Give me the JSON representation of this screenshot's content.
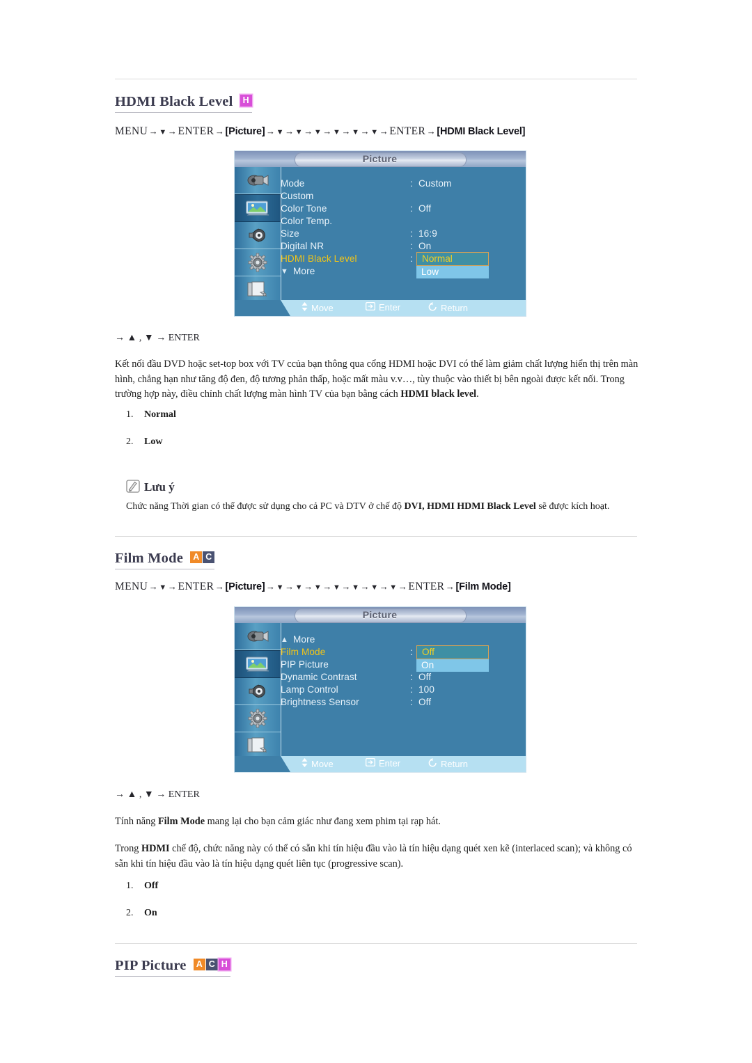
{
  "page": {
    "sections": [
      {
        "id": "hdmi-black-level",
        "heading": "HDMI Black Level",
        "badges": [
          "H"
        ],
        "breadcrumb": {
          "start": "MENU",
          "enter": "ENTER",
          "tag1": "[Picture]",
          "down_count_1": 1,
          "down_count_2": 6,
          "tag2": "[HDMI Black Level]"
        },
        "keyline": "→ ▲ , ▼ → ENTER",
        "paragraph_html": "Kết nối đầu DVD hoặc set-top box với TV ccủa bạn thông qua cổng HDMI hoặc DVI có thể làm giảm chất lượng hiển thị trên màn hình, chẳng hạn như tăng độ đen, độ tương phản thấp, hoặc mất màu v.v…, tùy thuộc vào thiết bị bên ngoài được kết nối. Trong trường hợp này, điều chỉnh chất lượng màn hình TV của bạn bằng cách <b>HDMI black level</b>.",
        "options": [
          {
            "num": "1.",
            "label": "Normal"
          },
          {
            "num": "2.",
            "label": "Low"
          }
        ],
        "note": {
          "title": "Lưu ý",
          "body_html": "Chức năng Thời gian có thể được sử dụng cho cả PC và DTV ở chế độ <b>DVI, HDMI HDMI Black Level</b> sẽ được kích hoạt."
        }
      },
      {
        "id": "film-mode",
        "heading": "Film Mode",
        "badges": [
          "A",
          "C"
        ],
        "breadcrumb": {
          "start": "MENU",
          "enter": "ENTER",
          "tag1": "[Picture]",
          "down_count_1": 1,
          "down_count_2": 7,
          "tag2": "[Film Mode]"
        },
        "keyline": "→ ▲ , ▼ → ENTER",
        "paragraph1_html": "Tính năng <b>Film Mode</b> mang lại cho bạn cảm giác như đang xem phim tại rạp hát.",
        "paragraph2_html": "Trong <b>HDMI</b> chế độ, chức năng này có thể có sẵn khi tín hiệu đầu vào là tín hiệu dạng quét xen kẽ (interlaced scan); và không có sẵn khi tín hiệu đầu vào là tín hiệu dạng quét liên tục (progressive scan).",
        "options": [
          {
            "num": "1.",
            "label": "Off"
          },
          {
            "num": "2.",
            "label": "On"
          }
        ]
      },
      {
        "id": "pip-picture",
        "heading": "PIP Picture",
        "badges": [
          "A",
          "C",
          "H"
        ]
      }
    ]
  },
  "osd1": {
    "title": "Picture",
    "rail_icons": [
      "input-source-icon",
      "picture-monitor-icon",
      "sound-speaker-icon",
      "setup-gear-icon",
      "multi-control-icon"
    ],
    "selected_rail_index": 1,
    "rows": [
      {
        "label": "Mode",
        "colon": ":",
        "value": "Custom",
        "state": "normal"
      },
      {
        "label": "Custom",
        "colon": "",
        "value": "",
        "state": "normal"
      },
      {
        "label": "Color Tone",
        "colon": ":",
        "value": "Off",
        "state": "normal"
      },
      {
        "label": "Color Temp.",
        "colon": "",
        "value": "",
        "state": "normal"
      },
      {
        "label": "Size",
        "colon": ":",
        "value": "16:9",
        "state": "normal"
      },
      {
        "label": "Digital NR",
        "colon": ":",
        "value": "On",
        "state": "normal"
      },
      {
        "label": "HDMI Black Level",
        "colon": ":",
        "value": "",
        "state": "highlight"
      },
      {
        "label": "More",
        "colon": "",
        "value": "",
        "state": "more-down"
      }
    ],
    "dropdown": {
      "selected": "Normal",
      "unselected": "Low"
    },
    "footer": [
      {
        "icon": "updown-arrow-icon",
        "label": "Move"
      },
      {
        "icon": "enter-key-icon",
        "label": "Enter"
      },
      {
        "icon": "return-arrow-icon",
        "label": "Return"
      }
    ]
  },
  "osd2": {
    "title": "Picture",
    "rail_icons": [
      "input-source-icon",
      "picture-monitor-icon",
      "sound-speaker-icon",
      "setup-gear-icon",
      "multi-control-icon"
    ],
    "selected_rail_index": 1,
    "rows": [
      {
        "label": "More",
        "colon": "",
        "value": "",
        "state": "more-up"
      },
      {
        "label": "Film Mode",
        "colon": ":",
        "value": "",
        "state": "highlight"
      },
      {
        "label": "PIP Picture",
        "colon": "",
        "value": "",
        "state": "normal"
      },
      {
        "label": "Dynamic Contrast",
        "colon": ":",
        "value": "Off",
        "state": "normal"
      },
      {
        "label": "Lamp Control",
        "colon": ":",
        "value": "100",
        "state": "normal"
      },
      {
        "label": "Brightness Sensor",
        "colon": ":",
        "value": "Off",
        "state": "normal"
      }
    ],
    "dropdown": {
      "selected": "Off",
      "unselected": "On"
    },
    "footer": [
      {
        "icon": "updown-arrow-icon",
        "label": "Move"
      },
      {
        "icon": "enter-key-icon",
        "label": "Enter"
      },
      {
        "icon": "return-arrow-icon",
        "label": "Return"
      }
    ]
  },
  "colors": {
    "badge_a": "#f08a28",
    "badge_c": "#4a5272",
    "badge_h": "#d84fd8",
    "heading": "#3b3b4f",
    "osd_bg": "#3e7fa8",
    "osd_highlight_text": "#f0c419",
    "osd_footer_bg": "#b6e0f2",
    "rule": "#d9d9d9"
  }
}
